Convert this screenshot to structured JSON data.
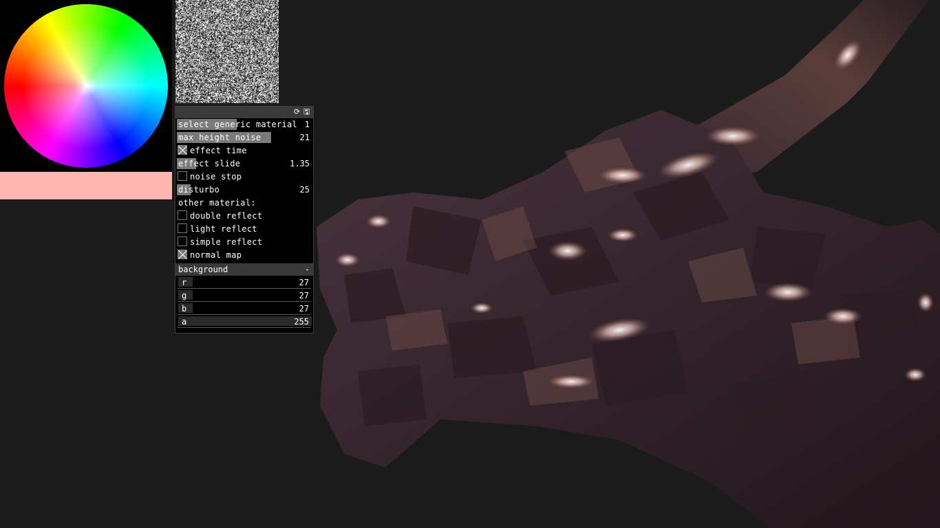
{
  "color_picker": {
    "selected_color": "#ffb6b0"
  },
  "panel": {
    "icons": [
      "refresh-icon",
      "save-icon"
    ],
    "controls": [
      {
        "type": "slider",
        "label": "select generic material",
        "value": "1",
        "fill": 0.44
      },
      {
        "type": "slider",
        "label": "max height noise",
        "value": "21",
        "fill": 0.69
      },
      {
        "type": "toggle",
        "label": "effect time",
        "checked": true
      },
      {
        "type": "slider",
        "label": "effect slide",
        "value": "1.35",
        "fill": 0.14
      },
      {
        "type": "toggle",
        "label": "noise stop",
        "checked": false
      },
      {
        "type": "slider",
        "label": "disturbo",
        "value": "25",
        "fill": 0.1
      },
      {
        "type": "label",
        "label": "other material:"
      },
      {
        "type": "toggle",
        "label": "double reflect",
        "checked": false
      },
      {
        "type": "toggle",
        "label": "light reflect",
        "checked": false
      },
      {
        "type": "toggle",
        "label": "simple reflect",
        "checked": false
      },
      {
        "type": "toggle",
        "label": "normal map",
        "checked": true
      }
    ],
    "background": {
      "title": "background",
      "collapse": "-",
      "channels": [
        {
          "label": "r",
          "value": "27",
          "fill": 0.106
        },
        {
          "label": "g",
          "value": "27",
          "fill": 0.106
        },
        {
          "label": "b",
          "value": "27",
          "fill": 0.106
        },
        {
          "label": "a",
          "value": "255",
          "fill": 1.0
        }
      ]
    }
  },
  "scene": {
    "background_color": "#1b1b1b",
    "object_color": "#3d2a30",
    "highlight_color": "#e8c2b8"
  }
}
